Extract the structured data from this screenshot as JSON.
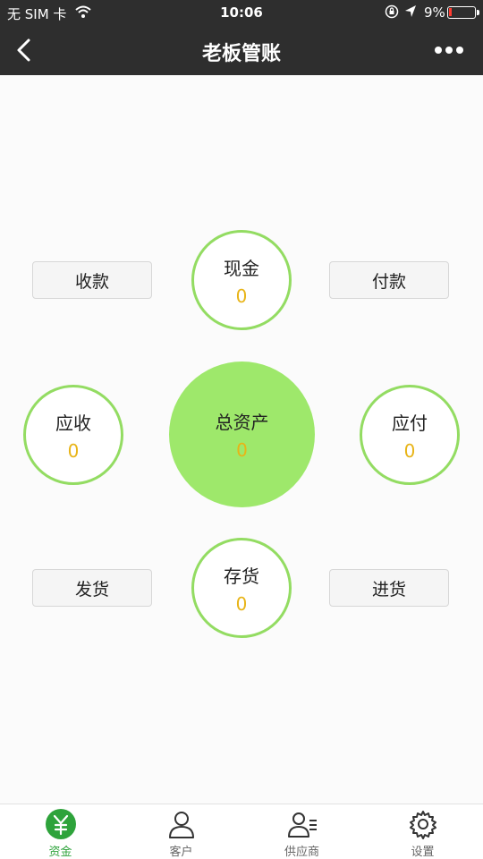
{
  "status_bar": {
    "carrier": "无 SIM 卡",
    "time": "10:06",
    "battery": "9%"
  },
  "nav": {
    "title": "老板管账",
    "back_icon": "chevron-left-icon",
    "more_icon": "more-dots-icon"
  },
  "dashboard": {
    "cash": {
      "label": "现金",
      "value": "0"
    },
    "total_assets": {
      "label": "总资产",
      "value": "0"
    },
    "receivable": {
      "label": "应收",
      "value": "0"
    },
    "payable": {
      "label": "应付",
      "value": "0"
    },
    "inventory": {
      "label": "存货",
      "value": "0"
    }
  },
  "actions": {
    "collect": "收款",
    "pay": "付款",
    "ship": "发货",
    "purchase": "进货"
  },
  "tabs": [
    {
      "label": "资金",
      "icon": "yen-icon",
      "active": true
    },
    {
      "label": "客户",
      "icon": "user-icon",
      "active": false
    },
    {
      "label": "供应商",
      "icon": "supplier-icon",
      "active": false
    },
    {
      "label": "设置",
      "icon": "gear-icon",
      "active": false
    }
  ],
  "colors": {
    "accent_green": "#93dc62",
    "center_fill": "#9ee86b",
    "value_yellow": "#e8b417",
    "bar_dark": "#2e2e2e",
    "active_tab": "#2ea33b"
  }
}
